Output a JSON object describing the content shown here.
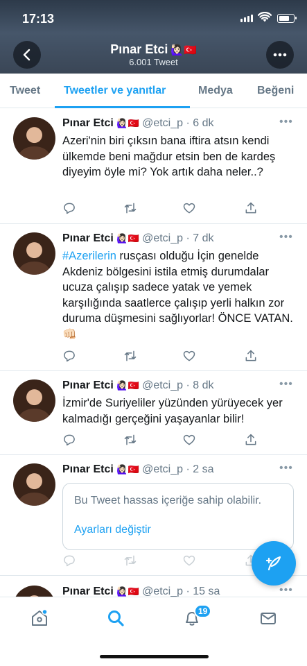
{
  "status_bar": {
    "time": "17:13"
  },
  "header": {
    "name": "Pınar Etci",
    "emojis": "🙋🏻‍♀️🇹🇷",
    "tweet_count": "6.001 Tweet"
  },
  "tabs": [
    {
      "label": "Tweet",
      "active": false
    },
    {
      "label": "Tweetler ve yanıtlar",
      "active": true
    },
    {
      "label": "Medya",
      "active": false
    },
    {
      "label": "Beğeni",
      "active": false
    }
  ],
  "tweets": [
    {
      "name": "Pınar Etci",
      "emojis": "🙋🏻‍♀️🇹🇷",
      "handle": "@etci_p",
      "time": "6 dk",
      "text": "Azeri'nin biri çıksın bana iftira atsın kendi ülkemde beni mağdur etsin ben de kardeş diyeyim öyle mi? Yok artık daha neler..?"
    },
    {
      "name": "Pınar Etci",
      "emojis": "🙋🏻‍♀️🇹🇷",
      "handle": "@etci_p",
      "time": "7 dk",
      "hashtag": "#Azerilerin",
      "text": " rusçası olduğu İçin genelde Akdeniz bölgesini istila etmiş durumdalar ucuza çalışıp sadece yatak ve yemek karşılığında saatlerce çalışıp yerli halkın zor duruma düşmesini sağlıyorlar! ÖNCE VATAN. ",
      "emoji_end": "👊🏻"
    },
    {
      "name": "Pınar Etci",
      "emojis": "🙋🏻‍♀️🇹🇷",
      "handle": "@etci_p",
      "time": "8 dk",
      "text": "İzmir'de Suriyeliler yüzünden yürüyecek yer kalmadığı gerçeğini yaşayanlar bilir!"
    },
    {
      "name": "Pınar Etci",
      "emojis": "🙋🏻‍♀️🇹🇷",
      "handle": "@etci_p",
      "time": "2 sa",
      "sensitive_message": "Bu Tweet hassas içeriğe sahip olabilir.",
      "sensitive_link": "Ayarları değiştir"
    },
    {
      "name": "Pınar Etci",
      "emojis": "🙋🏻‍♀️🇹🇷",
      "handle": "@etci_p",
      "time": "15 sa"
    }
  ],
  "separator": "·",
  "nav": {
    "notifications_badge": "19"
  },
  "colors": {
    "accent": "#1da1f2",
    "muted": "#657786",
    "border": "#e1e8ed"
  },
  "icons": [
    "back-arrow-icon",
    "more-icon",
    "reply-icon",
    "retweet-icon",
    "like-icon",
    "share-icon",
    "compose-icon",
    "home-icon",
    "search-icon",
    "notifications-icon",
    "messages-icon"
  ]
}
